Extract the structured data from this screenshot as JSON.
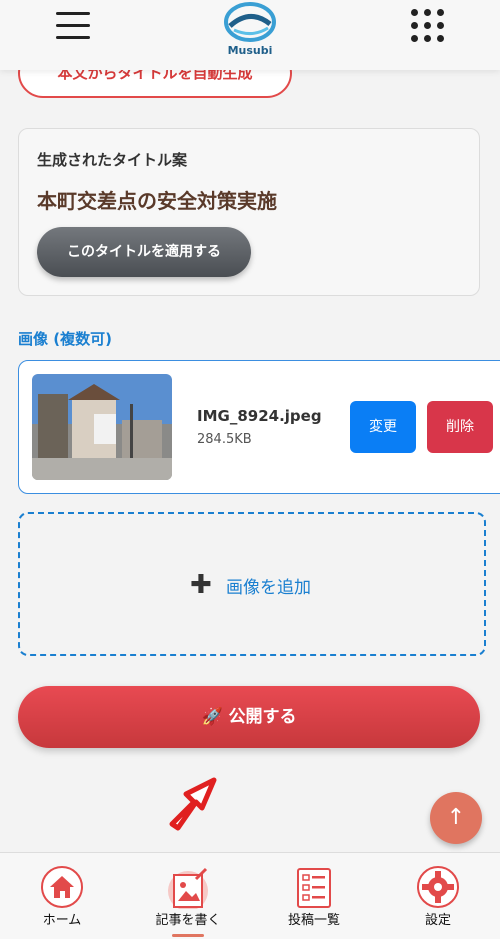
{
  "header": {
    "logo_text": "Musubi",
    "menu_icon": "hamburger-icon",
    "apps_icon": "grid-dots-icon"
  },
  "auto_title_button": "本文からタイトルを自動生成",
  "generated": {
    "label": "生成されたタイトル案",
    "title": "本町交差点の安全対策実施",
    "apply_button": "このタイトルを適用する"
  },
  "images": {
    "label": "画像 (複数可)",
    "items": [
      {
        "filename": "IMG_8924.jpeg",
        "size": "284.5KB",
        "change_label": "変更",
        "delete_label": "削除"
      }
    ],
    "add_label": "画像を追加",
    "add_icon_glyph": "✚"
  },
  "publish_button": "🚀 公開する",
  "scroll_top_glyph": "↑",
  "nav": [
    {
      "label": "ホーム",
      "icon": "home-icon"
    },
    {
      "label": "記事を書く",
      "icon": "write-icon"
    },
    {
      "label": "投稿一覧",
      "icon": "list-icon"
    },
    {
      "label": "設定",
      "icon": "gear-icon"
    }
  ],
  "colors": {
    "accent_red": "#e24a4a",
    "accent_blue": "#1a7fd0",
    "change_blue": "#0a7ef5",
    "delete_red": "#d8364a"
  }
}
